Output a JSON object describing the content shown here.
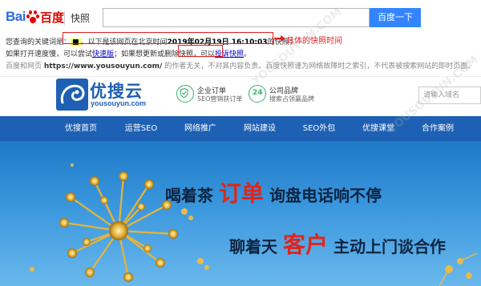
{
  "baidu": {
    "logo_part1": "Bai",
    "logo_part2": "百度",
    "cache_tab": "快照",
    "search_value": "",
    "search_button": "百度一下",
    "line1_prefix": "您查询的关键词是：",
    "line1_keyword": "■",
    "line1_middle": "。以下是该网页在北京时间",
    "line1_time": "2019年02月19日 16:10:03",
    "line1_suffix": "的快照；",
    "line2_prefix": "如果打开速度慢，可以尝试",
    "line2_link1": "快速版",
    "line2_middle": "；如果想更新或删除快照，可以",
    "line2_link2": "投诉快照",
    "line2_suffix": "。",
    "line3_prefix": "百度和网页",
    "line3_url": "https://www.yousouyun.com/",
    "line3_suffix": "的作者无关，不对其内容负责。百度快照谨为网络故障时之索引，不代表被搜索网站的即时页面。",
    "annotation": "具体的快照时间"
  },
  "site": {
    "logo_cn": "优搜云",
    "logo_en": "yousouyun.com",
    "features": [
      {
        "title": "企业订单",
        "subtitle": "SEO营销获订单"
      },
      {
        "title": "公司品牌",
        "subtitle": "搜索占领赢品牌"
      }
    ],
    "feature_icon_number": "24",
    "search_placeholder": "请输入域名",
    "nav": [
      "优搜首页",
      "运营SEO",
      "网络推广",
      "网站建设",
      "SEO外包",
      "优搜课堂",
      "合作案例"
    ],
    "banner": {
      "line1_a": "喝着茶",
      "line1_hl": "订单",
      "line1_b": "询盘电话响不停",
      "line2_a": "聊着天",
      "line2_hl": "客户",
      "line2_b": "主动上门谈合作"
    },
    "watermark": "YOUSOUYUN.COM"
  },
  "colors": {
    "baidu_blue": "#3385ff",
    "annotation_red": "#e02020",
    "brand_blue": "#1e60b3",
    "accent_green": "#35b36b",
    "slogan_red": "#e0241b"
  }
}
